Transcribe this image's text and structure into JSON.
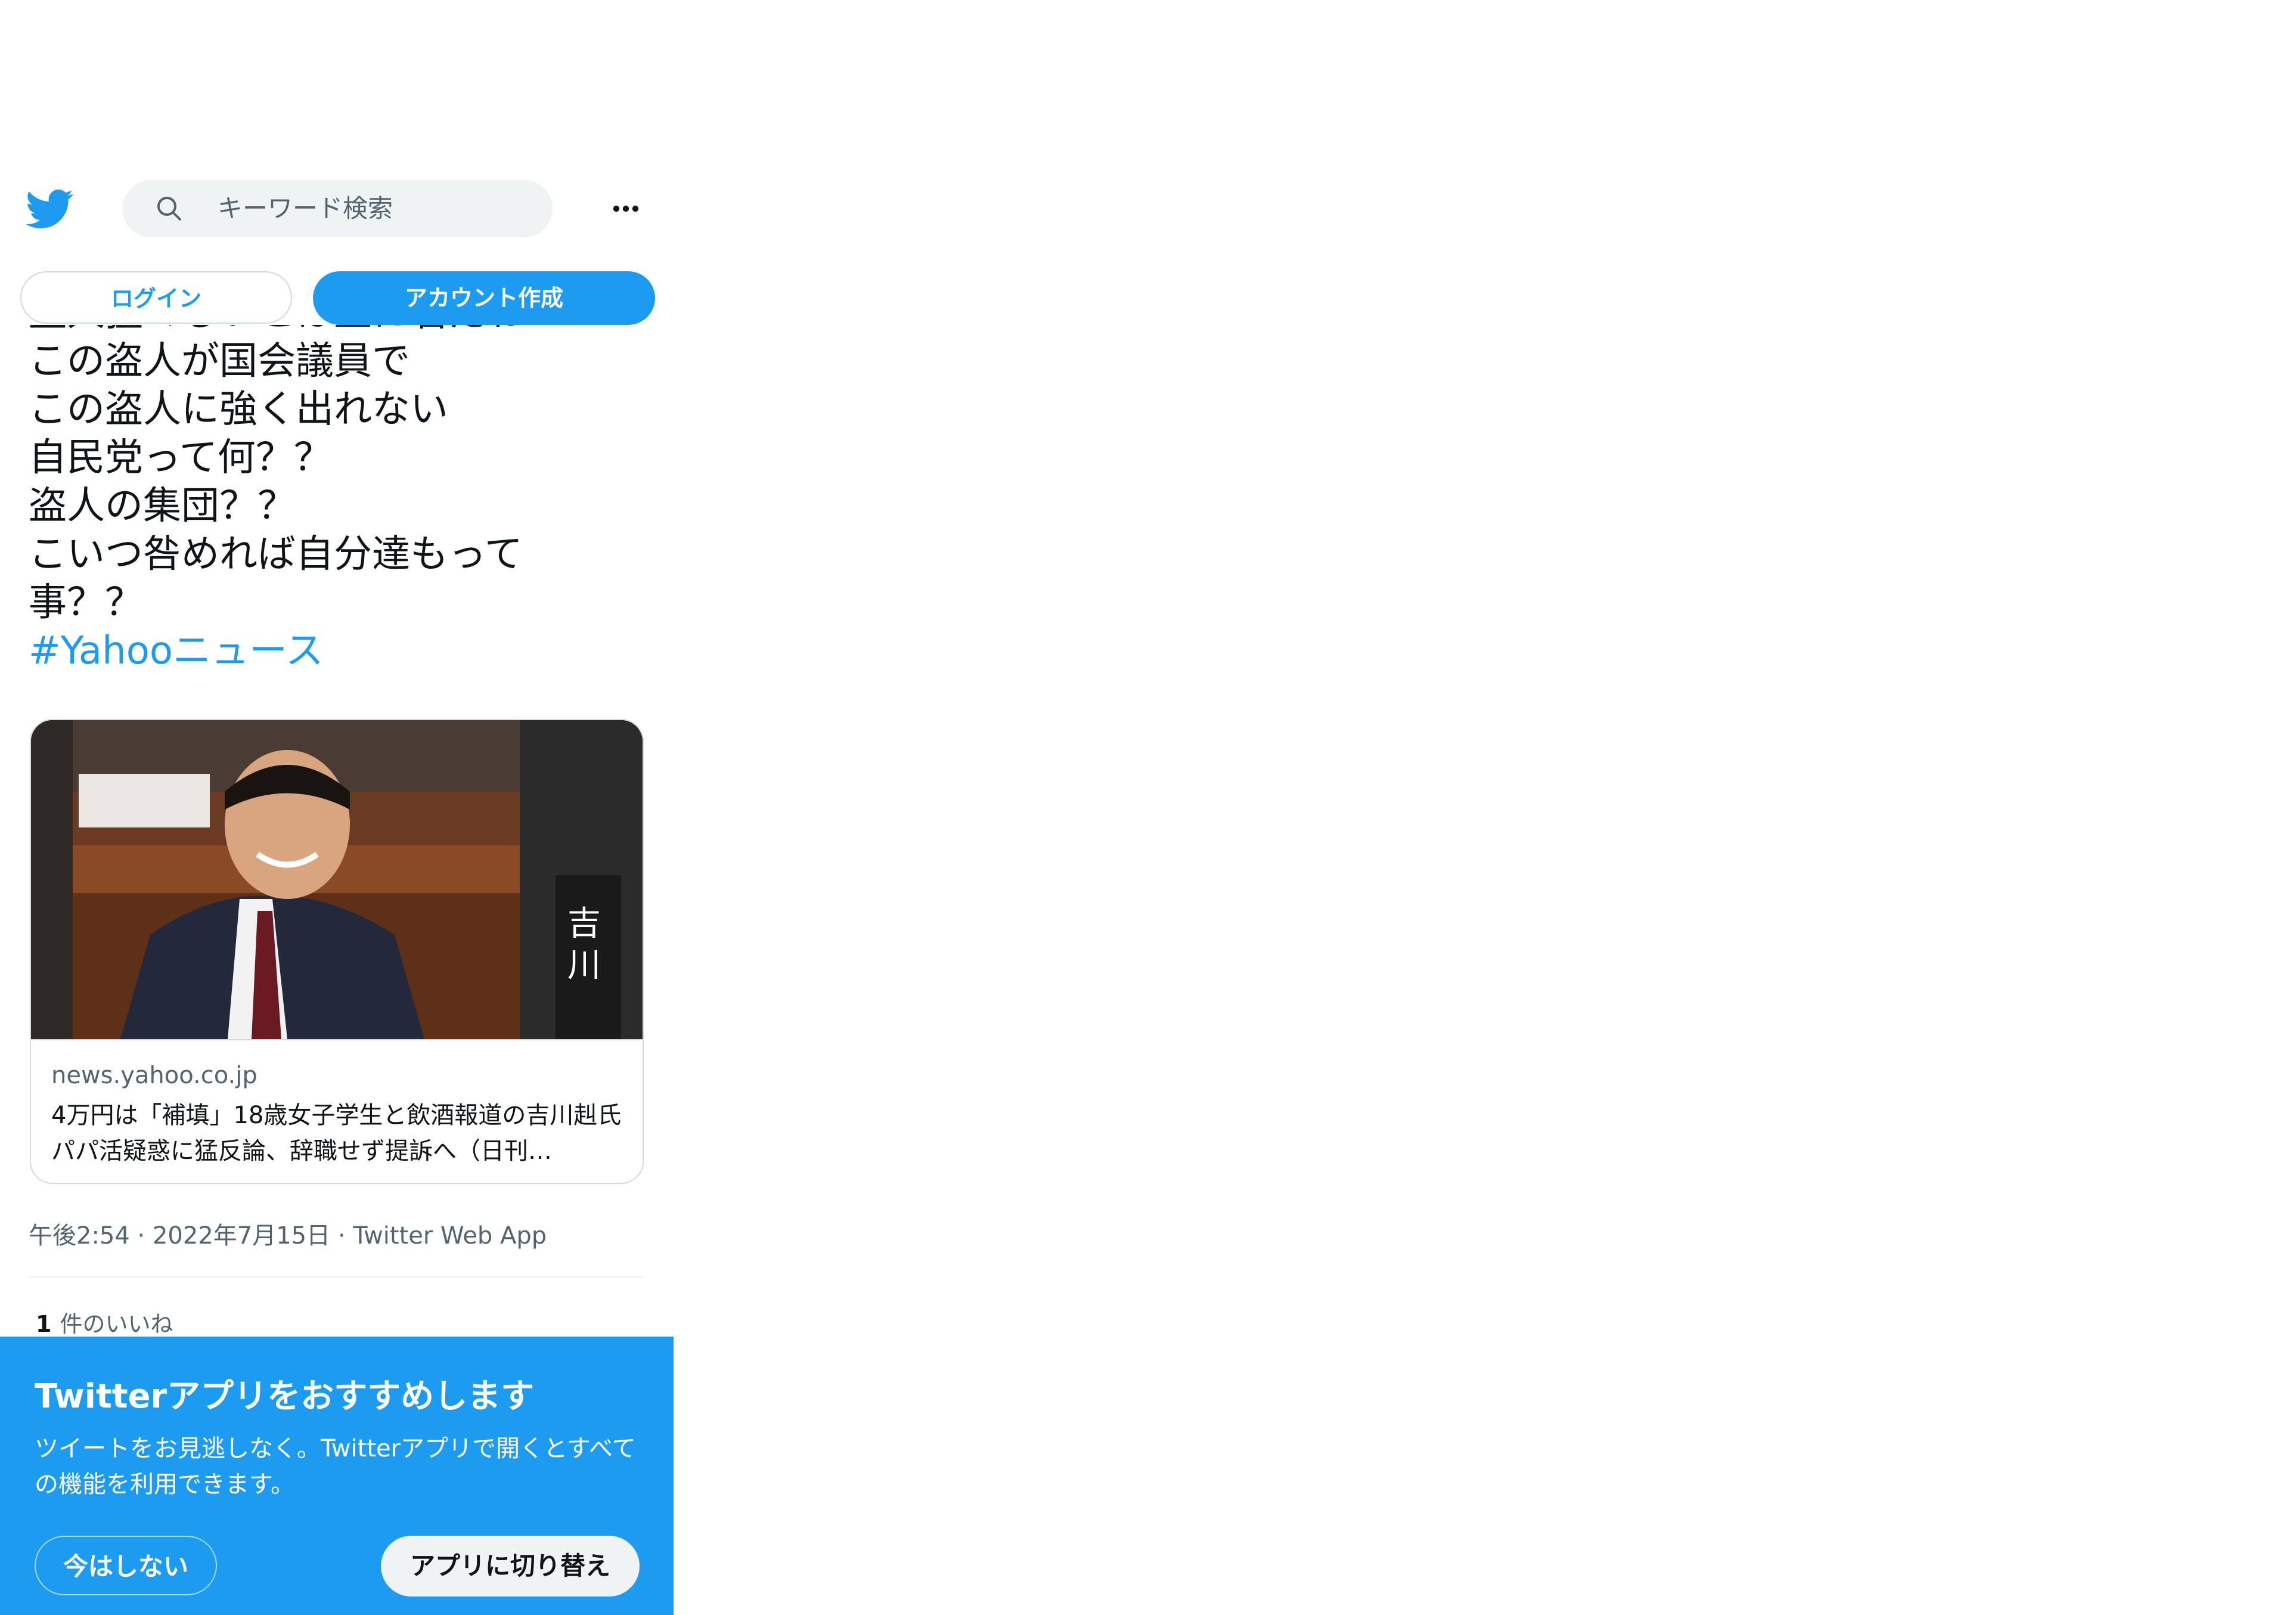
{
  "colors": {
    "accent": "#1d9bf0",
    "text_primary": "#0f1419",
    "text_secondary": "#536471",
    "border": "#cfd9de",
    "search_bg": "#eff3f4"
  },
  "header": {
    "logo_icon": "twitter-bird-icon",
    "search_placeholder": "キーワード検索",
    "more_icon": "more-dots-icon"
  },
  "auth": {
    "login_label": "ログイン",
    "signup_label": "アカウント作成"
  },
  "tweet": {
    "lines": [
      "盗人猛々しいとは正に君だね",
      "この盗人が国会議員で",
      "この盗人に強く出れない",
      "自民党って何？？",
      "盗人の集団？？",
      "こいつ咎めれば自分達もって",
      "事？？"
    ],
    "hashtag": "#Yahooニュース",
    "meta": "午後2:54 · 2022年7月15日 · Twitter Web App",
    "likes_count": "1",
    "likes_label": "件のいいね"
  },
  "card": {
    "image_alt": "news-photo",
    "domain": "news.yahoo.co.jp",
    "title": "4万円は「補填」18歳女子学生と飲酒報道の吉川赳氏　パパ活疑惑に猛反論、辞職せず提訴へ（日刊…"
  },
  "banner": {
    "title": "Twitterアプリをおすすめします",
    "description": "ツイートをお見逃しなく。Twitterアプリで開くとすべての機能を利用できます。",
    "not_now_label": "今はしない",
    "switch_label": "アプリに切り替え"
  }
}
